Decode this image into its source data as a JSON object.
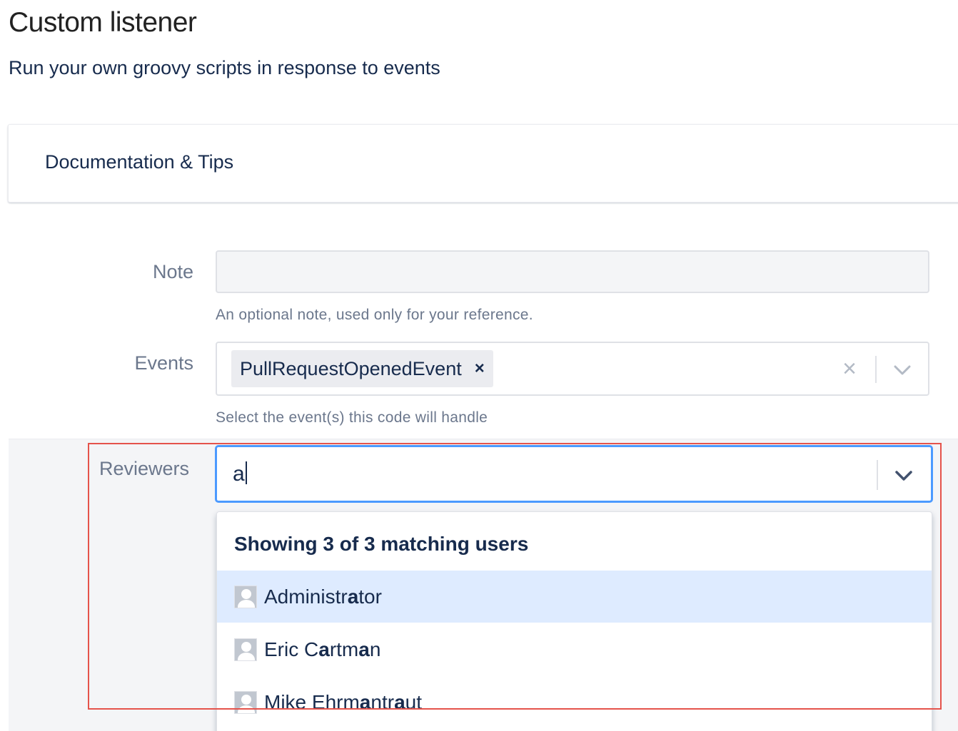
{
  "page": {
    "title": "Custom listener",
    "subtitle": "Run your own groovy scripts in response to events"
  },
  "documentation_panel": {
    "title": "Documentation & Tips"
  },
  "form": {
    "note": {
      "label": "Note",
      "value": "",
      "help": "An optional note, used only for your reference."
    },
    "events": {
      "label": "Events",
      "selected": [
        "PullRequestOpenedEvent"
      ],
      "tag_remove_symbol": "×",
      "clear_symbol": "×",
      "help": "Select the event(s) this code will handle"
    },
    "reviewers": {
      "label": "Reviewers",
      "value": "a",
      "menu": {
        "header": "Showing 3 of 3 matching users",
        "items": [
          {
            "name": "Administrator",
            "segments": [
              {
                "t": "Administr",
                "b": false
              },
              {
                "t": "a",
                "b": true
              },
              {
                "t": "tor",
                "b": false
              }
            ],
            "active": true
          },
          {
            "name": "Eric Cartman",
            "segments": [
              {
                "t": "Eric C",
                "b": false
              },
              {
                "t": "a",
                "b": true
              },
              {
                "t": "rtm",
                "b": false
              },
              {
                "t": "a",
                "b": true
              },
              {
                "t": "n",
                "b": false
              }
            ],
            "active": false
          },
          {
            "name": "Mike Ehrmantraut",
            "segments": [
              {
                "t": "Mike Ehrm",
                "b": false
              },
              {
                "t": "a",
                "b": true
              },
              {
                "t": "ntr",
                "b": false
              },
              {
                "t": "a",
                "b": true
              },
              {
                "t": "ut",
                "b": false
              }
            ],
            "active": false
          }
        ]
      }
    }
  },
  "colors": {
    "focus_border": "#4c9aff",
    "active_item_bg": "#deebff",
    "highlight_box": "#e5534b"
  },
  "icons": {
    "clear": "close-icon",
    "dropdown": "chevron-down-icon",
    "avatar": "default-avatar-icon"
  }
}
